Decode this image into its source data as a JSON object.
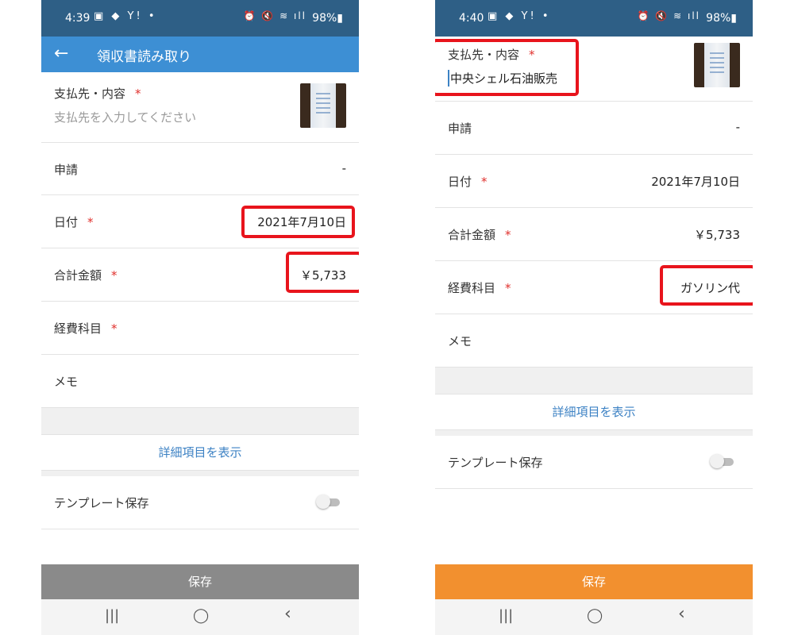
{
  "left": {
    "status_time": "4:39",
    "status_left_icons": "▣ ◆ Y! •",
    "status_right_icons": "⏰ 🔇 ≋ ıll",
    "battery": "98%▮",
    "header": {
      "title": "領収書読み取り"
    },
    "payee": {
      "label": "支払先・内容",
      "required_mark": "*",
      "placeholder": "支払先を入力してください"
    },
    "application": {
      "label": "申請",
      "value": "-"
    },
    "date": {
      "label": "日付",
      "required_mark": "*",
      "value": "2021年7月10日"
    },
    "total": {
      "label": "合計金額",
      "required_mark": "*",
      "value": "￥5,733"
    },
    "expense": {
      "label": "経費科目",
      "required_mark": "*"
    },
    "memo": {
      "label": "メモ"
    },
    "detail_link": "詳細項目を表示",
    "template": {
      "label": "テンプレート保存",
      "enabled": false
    },
    "save": "保存"
  },
  "right": {
    "status_time": "4:40",
    "status_left_icons": "▣ ◆ Y! •",
    "status_right_icons": "⏰ 🔇 ≋ ıll",
    "battery": "98%▮",
    "payee": {
      "label": "支払先・内容",
      "required_mark": "*",
      "value": "中央シェル石油販売"
    },
    "application": {
      "label": "申請",
      "value": "-"
    },
    "date": {
      "label": "日付",
      "required_mark": "*",
      "value": "2021年7月10日"
    },
    "total": {
      "label": "合計金額",
      "required_mark": "*",
      "value": "￥5,733"
    },
    "expense": {
      "label": "経費科目",
      "required_mark": "*",
      "value": "ガソリン代"
    },
    "memo": {
      "label": "メモ"
    },
    "detail_link": "詳細項目を表示",
    "template": {
      "label": "テンプレート保存",
      "enabled": false
    },
    "save": "保存"
  },
  "navbar": {
    "recents": "|||",
    "home": "◯",
    "back": "‹"
  },
  "colors": {
    "status_bar": "#2e5f86",
    "app_bar": "#3d8fd4",
    "save_disabled": "#8a8a8a",
    "save_enabled": "#f2902f",
    "required": "#e0302d",
    "link": "#3d82c4",
    "highlight": "#e8141c"
  }
}
